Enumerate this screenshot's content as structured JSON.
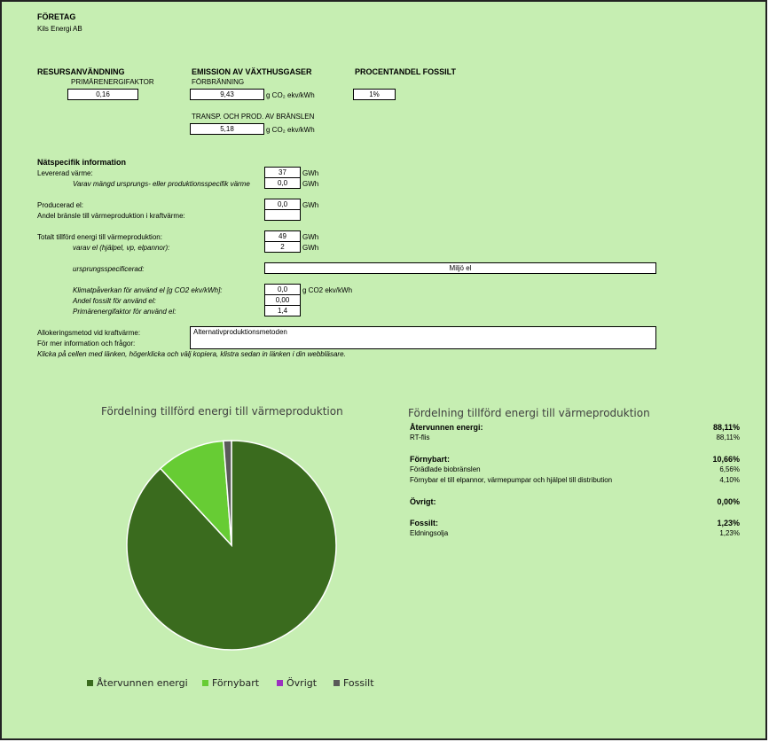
{
  "company": {
    "heading": "FÖRETAG",
    "name": "Kils Energi AB"
  },
  "resources": {
    "heading": "RESURSANVÄNDNING",
    "primary_label": "PRIMÄRENERGIFAKTOR",
    "primary_value": "0,16"
  },
  "emission": {
    "heading": "EMISSION AV VÄXTHUSGASER",
    "combustion_label": "FÖRBRÄNNING",
    "combustion_value": "9,43",
    "combustion_unit": "g CO₂ ekv/kWh",
    "transport_label": "TRANSP. OCH PROD. AV BRÄNSLEN",
    "transport_value": "5,18",
    "transport_unit": "g CO₂ ekv/kWh"
  },
  "fossil": {
    "heading": "PROCENTANDEL FOSSILT",
    "value": "1%"
  },
  "network": {
    "heading": "Nätspecifik information",
    "delivered_heat_label": "Levererad värme:",
    "delivered_heat_value": "37",
    "delivered_heat_unit": "GWh",
    "origin_specific_label": "Varav mängd ursprungs- eller produktionsspecifik värme",
    "origin_specific_value": "0,0",
    "origin_specific_unit": "GWh",
    "produced_el_label": "Producerad el:",
    "produced_el_value": "0,0",
    "produced_el_unit": "GWh",
    "fuel_share_label": "Andel bränsle till värmeproduktion i kraftvärme:",
    "fuel_share_value": "",
    "total_energy_label": "Totalt tillförd energi till värmeproduktion:",
    "total_energy_value": "49",
    "total_energy_unit": "GWh",
    "el_portion_label": "varav el (hjälpel, vp, elpannor):",
    "el_portion_value": "2",
    "el_portion_unit": "GWh",
    "origin_specified_label": "ursprungsspecificerad:",
    "origin_specified_value": "Miljö el",
    "climate_label": "Klimatpåverkan för använd el [g CO2 ekv/kWh]:",
    "climate_value": "0,0",
    "climate_unit": "g CO2 ekv/kWh",
    "fossil_el_label": "Andel fossilt för använd el:",
    "fossil_el_value": "0,00",
    "primary_el_label": "Primärenergifaktor för använd el:",
    "primary_el_value": "1,4",
    "alloc_label": "Allokeringsmetod vid kraftvärme:",
    "alloc_value": "Alternativproduktionsmetoden",
    "more_info_label": "För mer information och frågor:",
    "click_note": "Klicka på cellen med länken, högerklicka och välj kopiera, klistra sedan in länken i din webbläsare."
  },
  "chart_data": {
    "type": "pie",
    "title": "Fördelning tillförd energi till värmeproduktion",
    "categories": [
      "Återvunnen energi",
      "Förnybart",
      "Övrigt",
      "Fossilt"
    ],
    "values": [
      88.11,
      10.66,
      0.0,
      1.23
    ],
    "colors": [
      "#3a6b1e",
      "#67cc34",
      "#9b30c0",
      "#5a5a5a"
    ],
    "legend_position": "bottom"
  },
  "summary": {
    "title": "Fördelning tillförd energi till värmeproduktion",
    "recovered_label": "Återvunnen energi:",
    "recovered_value": "88,11%",
    "rtflis_label": "RT-flis",
    "rtflis_value": "88,11%",
    "renewable_label": "Förnybart:",
    "renewable_value": "10,66%",
    "biofuel_label": "Förädlade biobränslen",
    "biofuel_value": "6,56%",
    "renew_el_label": "Förnybar el till elpannor, värmepumpar och hjälpel till distribution",
    "renew_el_value": "4,10%",
    "other_label": "Övrigt:",
    "other_value": "0,00%",
    "fossil_label": "Fossilt:",
    "fossil_value": "1,23%",
    "oil_label": "Eldningsolja",
    "oil_value": "1,23%"
  }
}
